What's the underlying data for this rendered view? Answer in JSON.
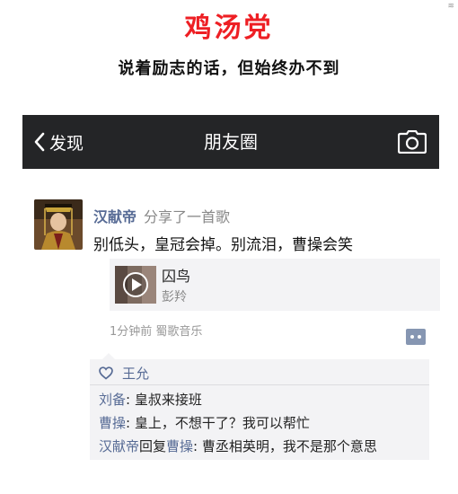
{
  "corner_mark": "≋",
  "banner": {
    "title": "鸡汤党",
    "subtitle": "说着励志的话，但始终办不到"
  },
  "navbar": {
    "back_label": "发现",
    "title": "朋友圈",
    "icons": {
      "back": "chevron-left-icon",
      "camera": "camera-icon"
    }
  },
  "post": {
    "author": "汉献帝",
    "action": "分享了一首歌",
    "text": "别低头，皇冠会掉。别流泪，曹操会笑",
    "music": {
      "title": "囚鸟",
      "artist": "彭羚",
      "icon": "play-icon"
    },
    "meta": "1分钟前  蜀歌音乐",
    "comment_icon": "comment-icon"
  },
  "interactions": {
    "likes_icon": "heart-icon",
    "likes": [
      "王允"
    ],
    "comments": [
      {
        "name": "刘备",
        "text": ": 皇叔来接班"
      },
      {
        "name": "曹操",
        "text": ": 皇上，不想干了？我可以帮忙"
      },
      {
        "name": "汉献帝",
        "reply_word": "回复",
        "reply_to": "曹操",
        "text": ": 曹丞相英明，我不是那个意思"
      }
    ]
  },
  "colors": {
    "banner_title": "#ee1f24",
    "navbar_bg": "#242527",
    "name_link": "#576b95",
    "panel_bg": "#f3f3f5"
  }
}
